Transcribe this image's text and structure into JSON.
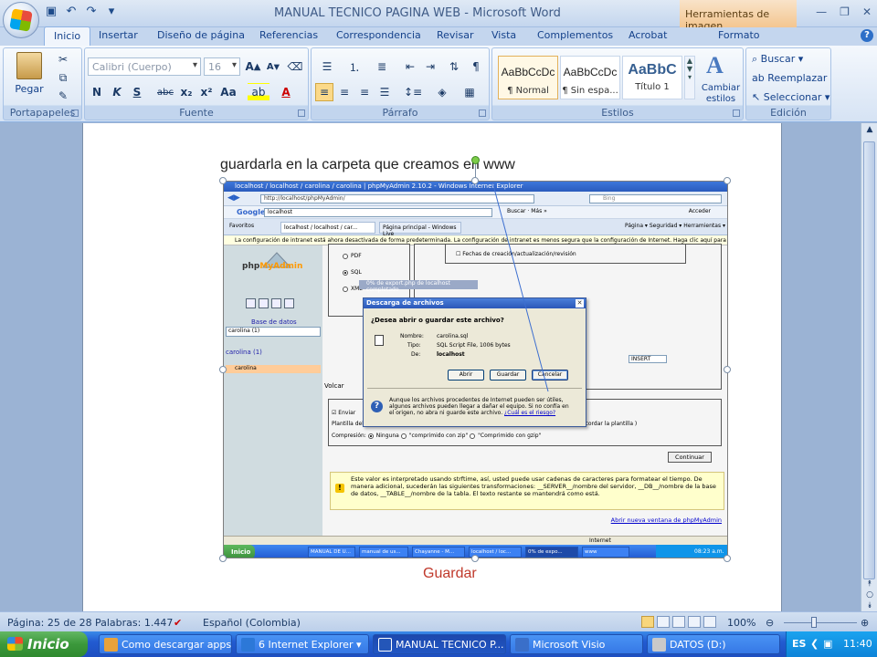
{
  "app": {
    "title": "MANUAL TECNICO PAGINA WEB - Microsoft Word",
    "context_tab_header": "Herramientas de imagen"
  },
  "qat": {
    "save_icon": "save-icon",
    "undo_icon": "undo-icon",
    "redo_icon": "redo-icon"
  },
  "tabs": [
    "Inicio",
    "Insertar",
    "Diseño de página",
    "Referencias",
    "Correspondencia",
    "Revisar",
    "Vista",
    "Complementos",
    "Acrobat",
    "Formato"
  ],
  "ribbon": {
    "clipboard": {
      "label": "Portapapeles",
      "paste": "Pegar"
    },
    "font": {
      "label": "Fuente",
      "font_name": "Calibri (Cuerpo)",
      "font_size": "16"
    },
    "paragraph": {
      "label": "Párrafo"
    },
    "styles": {
      "label": "Estilos",
      "items": [
        {
          "preview": "AaBbCcDc",
          "name": "¶ Normal"
        },
        {
          "preview": "AaBbCcDc",
          "name": "¶ Sin espa..."
        },
        {
          "preview": "AaBbC",
          "name": "Título 1"
        }
      ],
      "change": "Cambiar estilos"
    },
    "editing": {
      "label": "Edición",
      "find": "Buscar",
      "replace": "Reemplazar",
      "select": "Seleccionar"
    }
  },
  "document": {
    "heading": "guardarla en la carpeta  que creamos en www",
    "caption": "Guardar"
  },
  "screenshot": {
    "title": "localhost / localhost / carolina / carolina | phpMyAdmin 2.10.2 - Windows Internet Explorer",
    "url": "http://localhost/phpMyAdmin/",
    "search_engine": "Bing",
    "google_label": "Google",
    "google_query": "localhost",
    "google_buttons": "Buscar · Más »",
    "access": "Acceder",
    "tab1": "localhost / localhost / car...",
    "tab2": "Página principal - Windows Live",
    "favorites": "Favoritos",
    "tools": "Página ▾  Seguridad ▾  Herramientas ▾",
    "infobar": "La configuración de intranet está ahora desactivada de forma predeterminada. La configuración de intranet es menos segura que la configuración de Internet. Haga clic aquí para ver  opciones...",
    "pma": {
      "logo_a": "php",
      "logo_b": "MyAdmin",
      "db_label": "Base de datos",
      "db_select": "carolina (1)",
      "db_name": "carolina (1)",
      "table": "carolina"
    },
    "export": {
      "fmt_pdf": "PDF",
      "fmt_sql": "SQL",
      "fmt_xml": "XML",
      "opt_dates": "Fechas de creación/actualización/revisión",
      "insert": "INSERT",
      "volcar": "Volcar",
      "enviar": "Enviar",
      "plantilla": "Plantilla del nombre del archivo",
      "plantilla_val": "carolina",
      "recordar": "Recordar la plantilla )",
      "compresion": "Compresión:",
      "ninguna": "Ninguna",
      "zip": "\"comprimido con zip\"",
      "gzip": "\"Comprimido con gzip\"",
      "continuar": "Continuar",
      "note": "Este valor es interpretado usando strftime, así, usted puede usar cadenas de caracteres para formatear el tiempo. De manera adicional, sucederán las siguientes transformaciones: __SERVER__/nombre del servidor, __DB__/nombre de la base de datos, __TABLE__/nombre de la tabla. El texto restante se mantendrá como está.",
      "newwin": "Abrir nueva ventana de phpMyAdmin"
    },
    "progress_title": "0% de export.php de localhost completado",
    "dialog": {
      "title": "Descarga de archivos",
      "question": "¿Desea abrir o guardar este archivo?",
      "name_label": "Nombre:",
      "name_value": "carolina.sql",
      "type_label": "Tipo:",
      "type_value": "SQL Script File, 1006 bytes",
      "from_label": "De:",
      "from_value": "localhost",
      "open": "Abrir",
      "save": "Guardar",
      "cancel": "Cancelar",
      "warning": "Aunque los archivos procedentes de Internet pueden ser útiles, algunos archivos pueden llegar a dañar el equipo. Si no confía en el origen, no abra ni guarde este archivo.",
      "warning_link": "¿Cuál es el riesgo?"
    },
    "status_zone": "Internet",
    "taskbar": {
      "start": "Inicio",
      "items": [
        "MANUAL DE U...",
        "manual de us...",
        "Chayanne - M...",
        "localhost / loc...",
        "0% de expo...",
        "www"
      ],
      "clock": "08:23 a.m."
    }
  },
  "statusbar": {
    "page": "Página: 25 de 28",
    "words": "Palabras: 1.447",
    "language": "Español (Colombia)",
    "zoom": "100%"
  },
  "taskbar": {
    "start": "Inicio",
    "items": [
      {
        "label": "Como descargar apps...",
        "color": "#e8a23a"
      },
      {
        "label": "6 Internet Explorer",
        "color": "#2c78d8"
      },
      {
        "label": "MANUAL TECNICO P...",
        "color": "#2456b8"
      },
      {
        "label": "Microsoft Visio",
        "color": "#3a6fc9"
      },
      {
        "label": "DATOS (D:)",
        "color": "#c9c9c9"
      }
    ],
    "lang": "ES",
    "clock": "11:40"
  }
}
